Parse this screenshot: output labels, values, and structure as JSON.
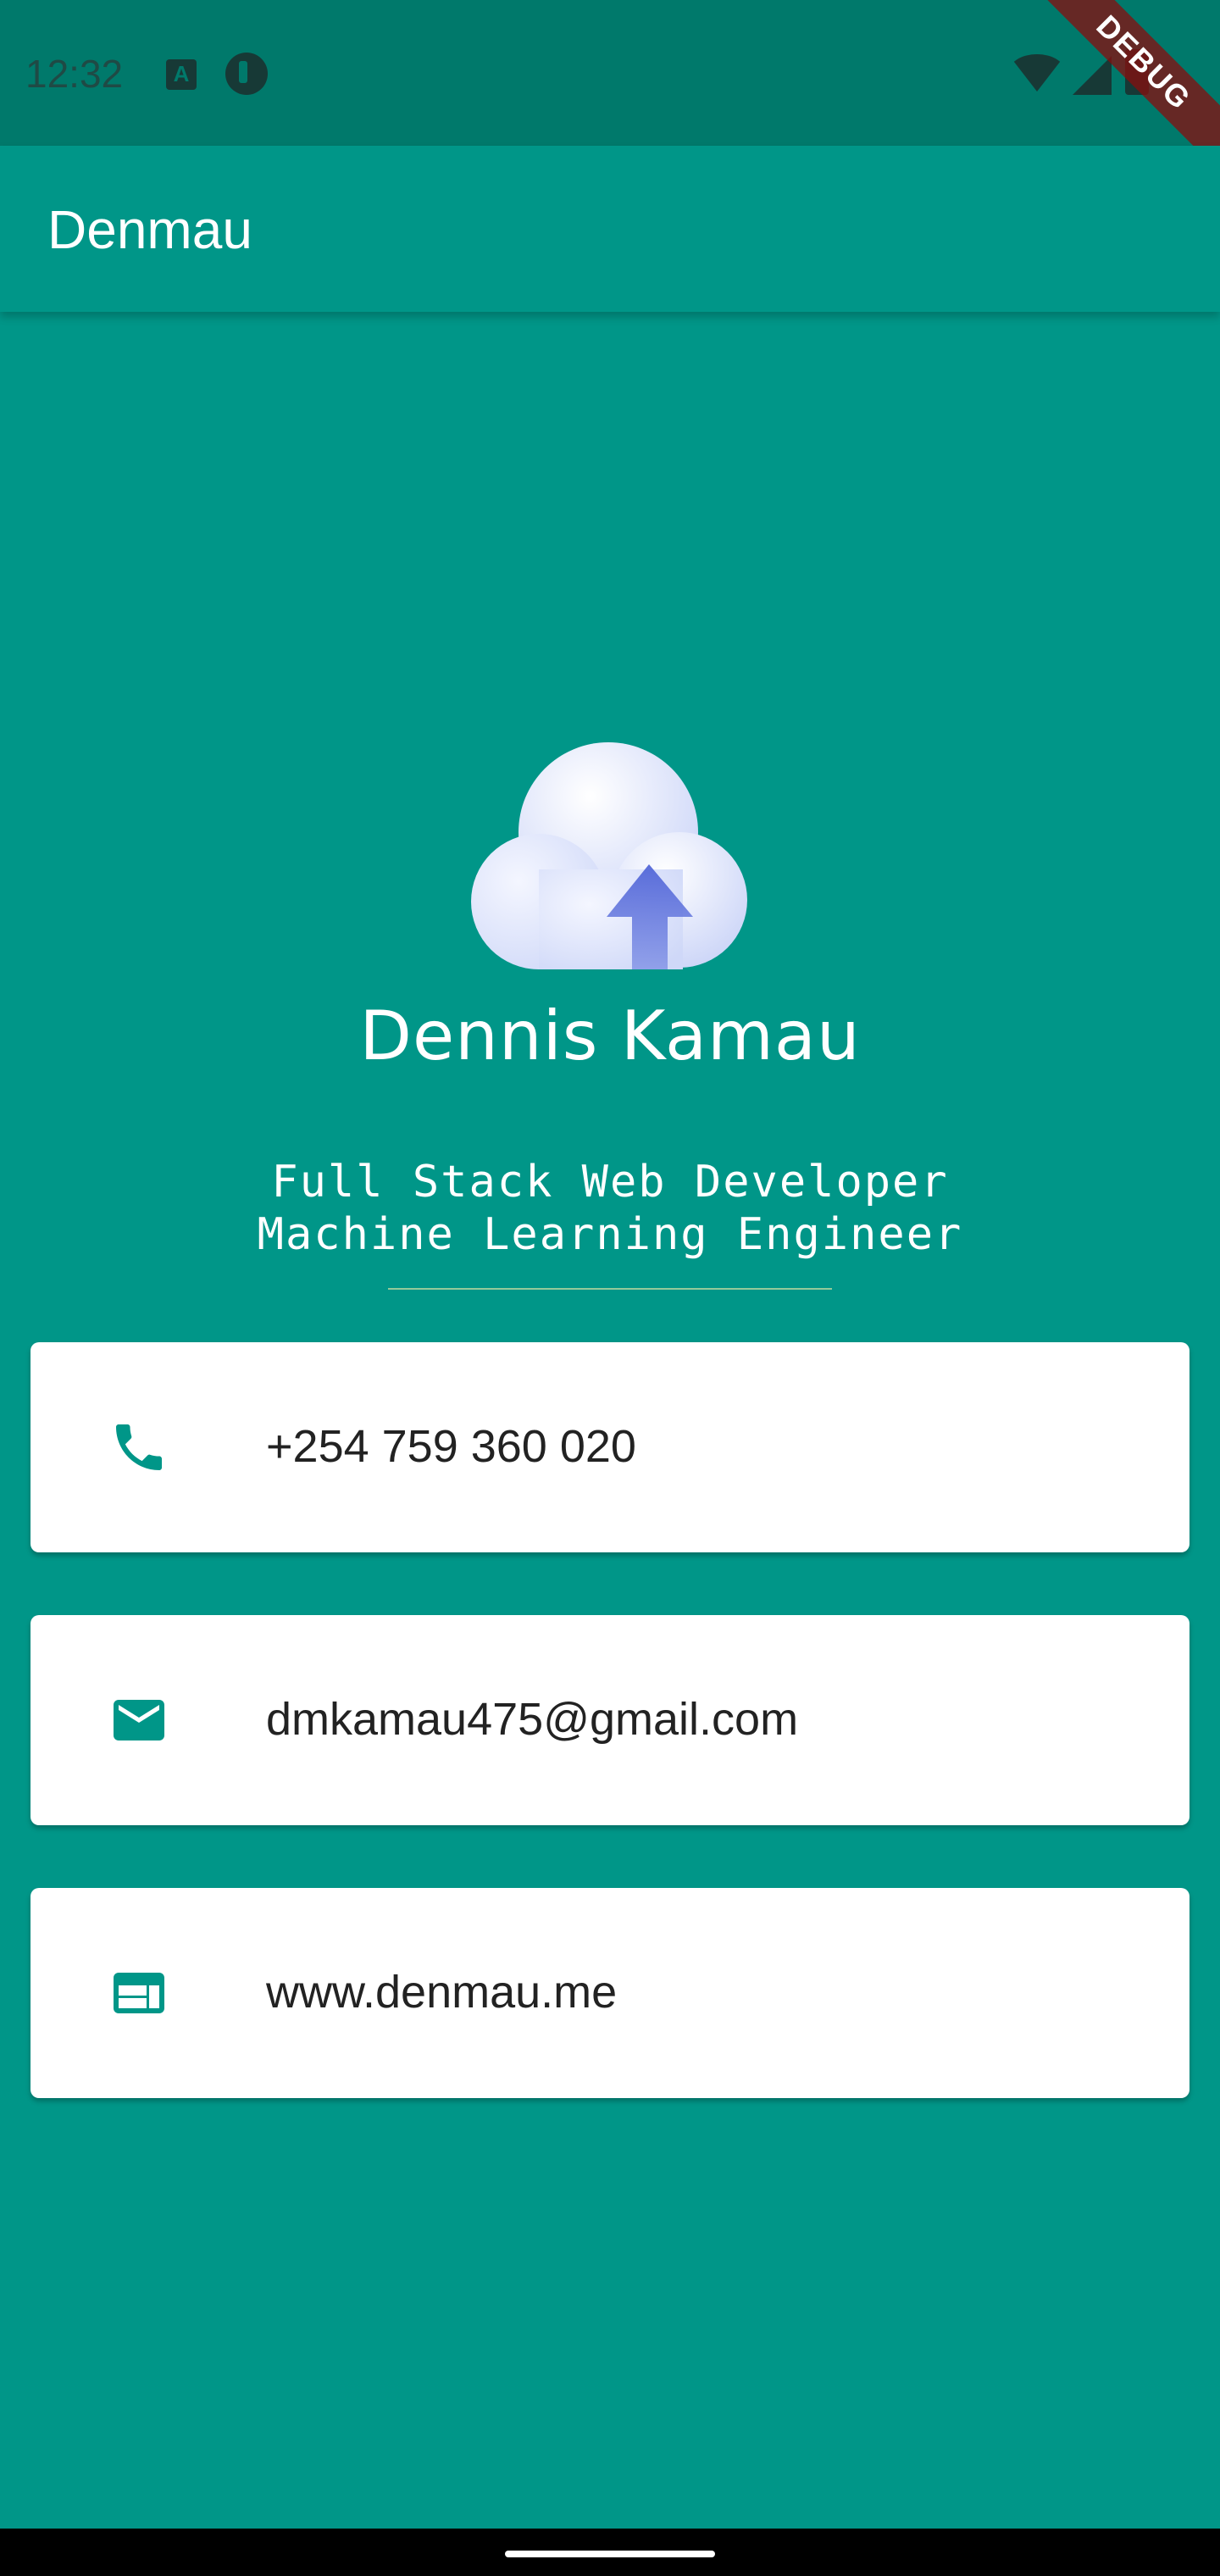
{
  "status_bar": {
    "time": "12:32",
    "left_icons": [
      "a-badge-icon",
      "alert-circle-icon"
    ],
    "right_icons": [
      "wifi-off-icon",
      "signal-icon",
      "battery-icon"
    ]
  },
  "debug_banner": "DEBUG",
  "app_bar": {
    "title": "Denmau"
  },
  "profile": {
    "name": "Dennis Kamau",
    "title_line_1": "Full Stack Web Developer",
    "title_line_2": "Machine Learning Engineer",
    "logo_icon": "cloud-upload-icon"
  },
  "contacts": [
    {
      "icon": "phone-icon",
      "value": "+254 759 360 020"
    },
    {
      "icon": "mail-icon",
      "value": "dmkamau475@gmail.com"
    },
    {
      "icon": "web-icon",
      "value": "www.denmau.me"
    }
  ],
  "colors": {
    "primary": "#009688",
    "status_bar": "#00796b",
    "card": "#ffffff",
    "icon": "#009688"
  }
}
